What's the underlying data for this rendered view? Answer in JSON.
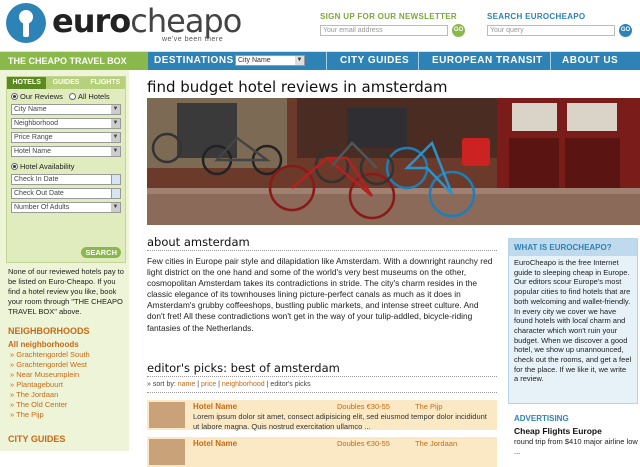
{
  "header": {
    "logo_text_1": "euro",
    "logo_text_2": "cheapo",
    "tagline": "we've been there",
    "newsletter_label": "SIGN UP FOR OUR NEWSLETTER",
    "newsletter_placeholder": "Your email address",
    "newsletter_go": "GO",
    "search_label": "SEARCH EUROCHEAPO",
    "search_placeholder": "Your query",
    "search_go": "GO"
  },
  "nav": {
    "travel_box": "THE CHEAPO TRAVEL BOX",
    "destinations": "DESTINATIONS",
    "destinations_select": "City Name",
    "city_guides": "CITY GUIDES",
    "european_transit": "EUROPEAN TRANSIT",
    "about_us": "ABOUT US"
  },
  "travel_box": {
    "tabs": [
      "HOTELS",
      "GUIDES",
      "FLIGHTS"
    ],
    "radio_our_reviews": "Our Reviews",
    "radio_all_hotels": "All Hotels",
    "city_name": "City Name",
    "neighborhood": "Neighborhood",
    "price_range": "Price Range",
    "hotel_name": "Hotel Name",
    "hotel_availability": "Hotel Availability",
    "check_in": "Check In Date",
    "check_out": "Check Out Date",
    "adults": "Number Of Adults",
    "search": "SEARCH"
  },
  "sidebar": {
    "note": "None of our reviewed hotels pay to be listed on Euro-Cheapo. If you find a hotel review you like, book your room through \"THE CHEAPO TRAVEL BOX\" above.",
    "neighborhoods_heading": "NEIGHBORHOODS",
    "all_neighborhoods": "All neighborhoods",
    "neighborhoods": [
      "Grachtengordel South",
      "Grachtengordel West",
      "Near Museumplein",
      "Plantagebuurt",
      "The Jordaan",
      "The Old Center",
      "The Pijp"
    ],
    "city_guides_heading": "CITY GUIDES"
  },
  "main": {
    "title": "find budget hotel reviews in amsterdam",
    "about_heading": "about amsterdam",
    "about_text": "Few cities in Europe pair style and dilapidation like Amsterdam. With a downright raunchy red light district on the one hand and some of the world's very best museums on the other, cosmopolitan Amsterdam takes its contradictions in stride. The city's charm resides in the classic elegance of its townhouses lining picture-perfect canals as much as it does in Amsterdam's grubby coffeeshops, bustling public markets, and intense street culture. And don't fret! All these contradictions won't get in the way of your tulip-addled, bicycle-riding fantasies of the Netherlands.",
    "picks_heading": "editor's picks: best of amsterdam",
    "sort_prefix": "» sort by: ",
    "sort_name": "name",
    "sort_price": "price",
    "sort_neighborhood": "neighborhood",
    "sort_editors": "editor's picks",
    "sort_sep": " | ",
    "hotels": [
      {
        "name": "Hotel Name",
        "price": "Doubles €30-55",
        "location": "The Pijp",
        "desc": "Lorem ipsum dolor sit amet, consect adipisicing elit, sed eiusmod tempor dolor incididunt ut labore magna. Quis nostrud exercitation ullamco ..."
      },
      {
        "name": "Hotel Name",
        "price": "Doubles €30-55",
        "location": "The Jordaan",
        "desc": ""
      }
    ]
  },
  "right": {
    "what_title": "WHAT IS EUROCHEAPO?",
    "what_text": "EuroCheapo is the free Internet guide to sleeping cheap in Europe. Our editors scour Europe's most popular cities to find hotels that are both welcoming and wallet-friendly. In every city we cover we have found hotels with local charm and character which won't ruin your budget. When we discover a good hotel, we show up unannounced, check out the rooms, and get a feel for the place. If we like it, we write a review.",
    "adv_title": "ADVERTISING",
    "adv_name": "Cheap Flights Europe",
    "adv_text": "round trip from $410 major airline low ..."
  }
}
